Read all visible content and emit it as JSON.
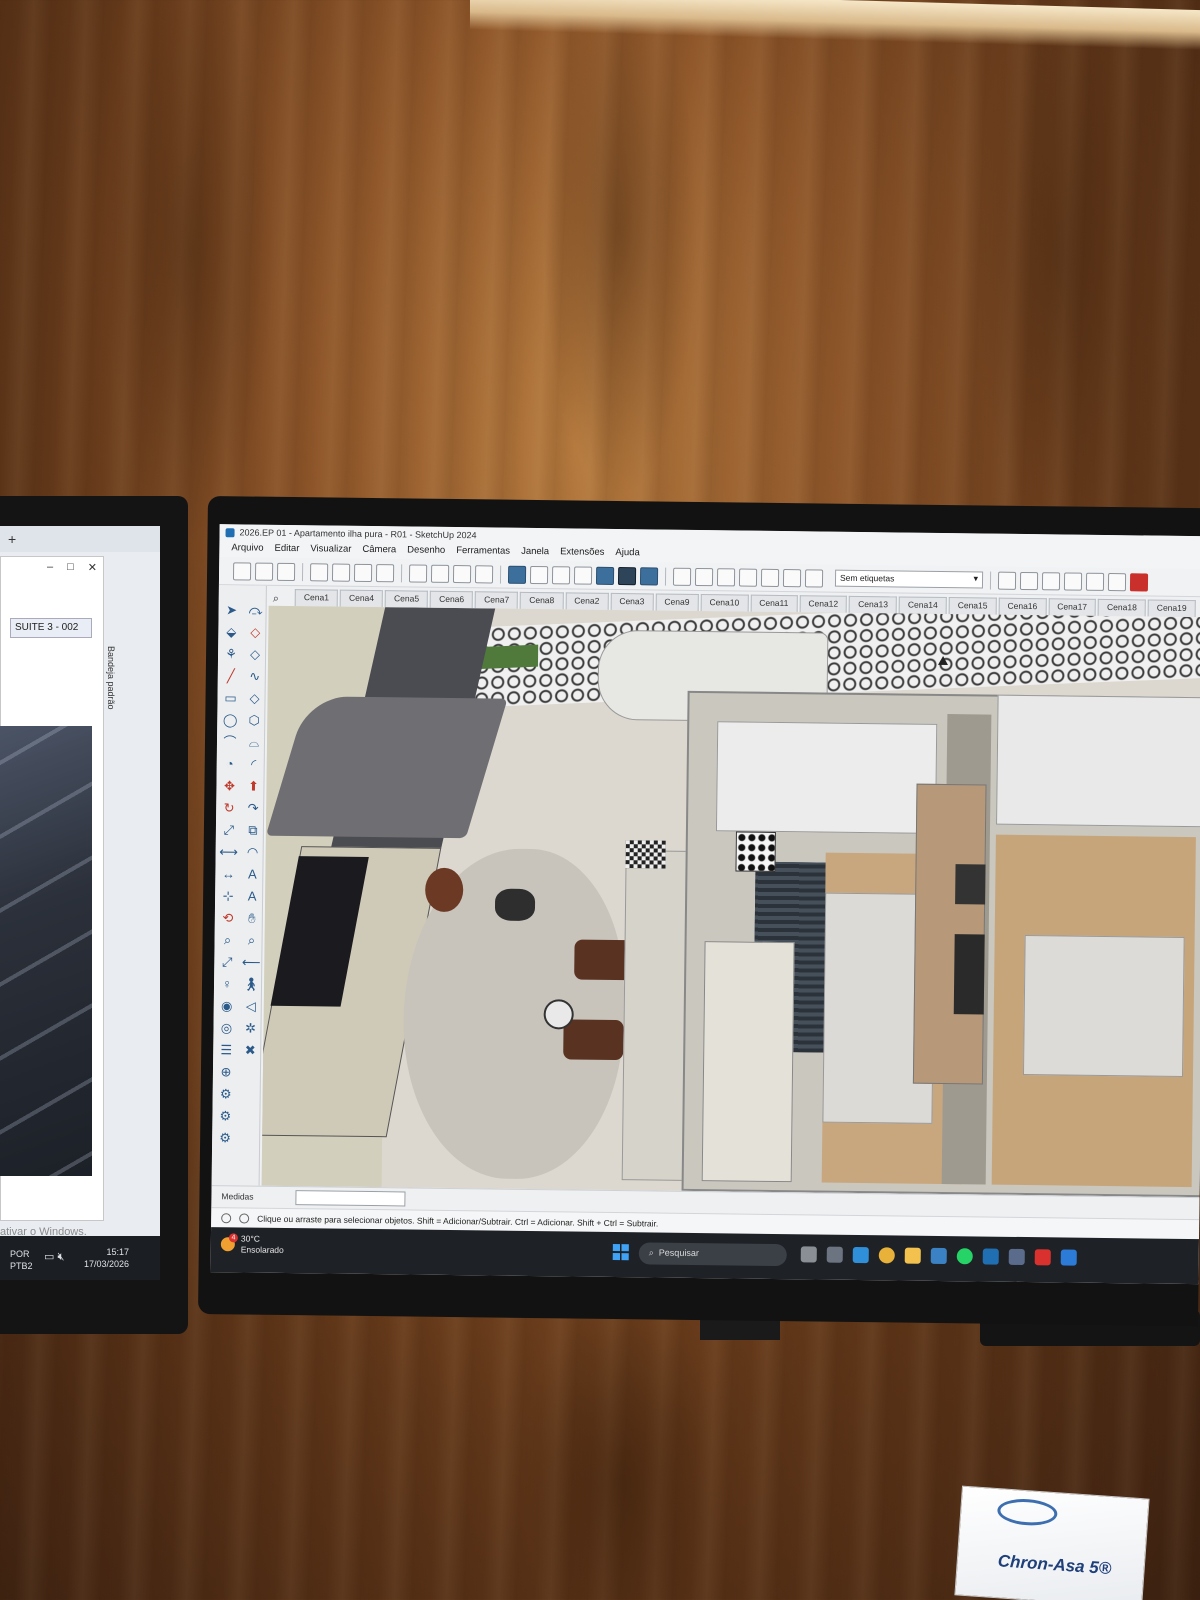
{
  "left_monitor": {
    "tab_plus": "+",
    "suite_tab": "SUITE 3 - 002",
    "sidebar_label": "Bandeja padrão",
    "activate_text": "ativar o Windows.",
    "taskbar": {
      "lang1": "POR",
      "lang2": "PTB2",
      "time": "15:17",
      "date": "17/03/2026"
    }
  },
  "sketchup": {
    "window_title": "2026.EP 01 - Apartamento ilha pura - R01 - SketchUp 2024",
    "menu": [
      "Arquivo",
      "Editar",
      "Visualizar",
      "Câmera",
      "Desenho",
      "Ferramentas",
      "Janela",
      "Extensões",
      "Ajuda"
    ],
    "tags_dropdown": "Sem etiquetas",
    "scenes": [
      "Cena1",
      "Cena4",
      "Cena5",
      "Cena6",
      "Cena7",
      "Cena8",
      "Cena2",
      "Cena3",
      "Cena9",
      "Cena10",
      "Cena11",
      "Cena12",
      "Cena13",
      "Cena14",
      "Cena15",
      "Cena16",
      "Cena17",
      "Cena18",
      "Cena19"
    ],
    "measures_label": "Medidas",
    "status_text": "Clique ou arraste para selecionar objetos. Shift = Adicionar/Subtrair. Ctrl = Adicionar. Shift + Ctrl = Subtrair."
  },
  "taskbar": {
    "temperature": "30°C",
    "weather": "Ensolarado",
    "weather_badge": "4",
    "search_placeholder": "Pesquisar"
  },
  "medicine_box": {
    "brand": "Chron-Asa 5®"
  }
}
